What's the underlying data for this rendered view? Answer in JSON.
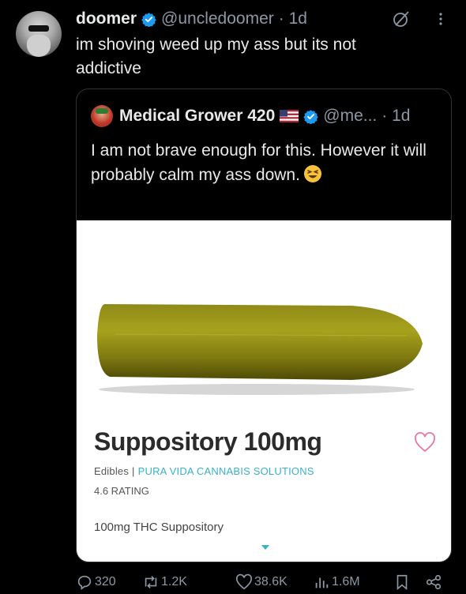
{
  "tweet": {
    "author_name": "doomer",
    "author_handle": "@uncledoomer",
    "time": "· 1d",
    "text": "im shoving weed up my ass but its not addictive"
  },
  "quoted_tweet": {
    "author_name": "Medical Grower 420",
    "author_handle": "@me...",
    "time": "· 1d",
    "text": "I am not brave enough for this. However it will probably calm my ass down."
  },
  "product_card": {
    "title": "Suppository 100mg",
    "category": "Edibles",
    "separator": "|",
    "brand": "PURA VIDA CANNABIS SOLUTIONS",
    "rating": "4.6 RATING",
    "description": "100mg THC Suppository",
    "brand_color": "#3bb0c9"
  },
  "actions": {
    "replies": "320",
    "reposts": "1.2K",
    "likes": "38.6K",
    "views": "1.6M"
  },
  "colors": {
    "background": "#000000",
    "text": "#e7e9ea",
    "muted": "#8b98a5",
    "verified": "#1d9bf0",
    "heart": "#e8789a"
  }
}
